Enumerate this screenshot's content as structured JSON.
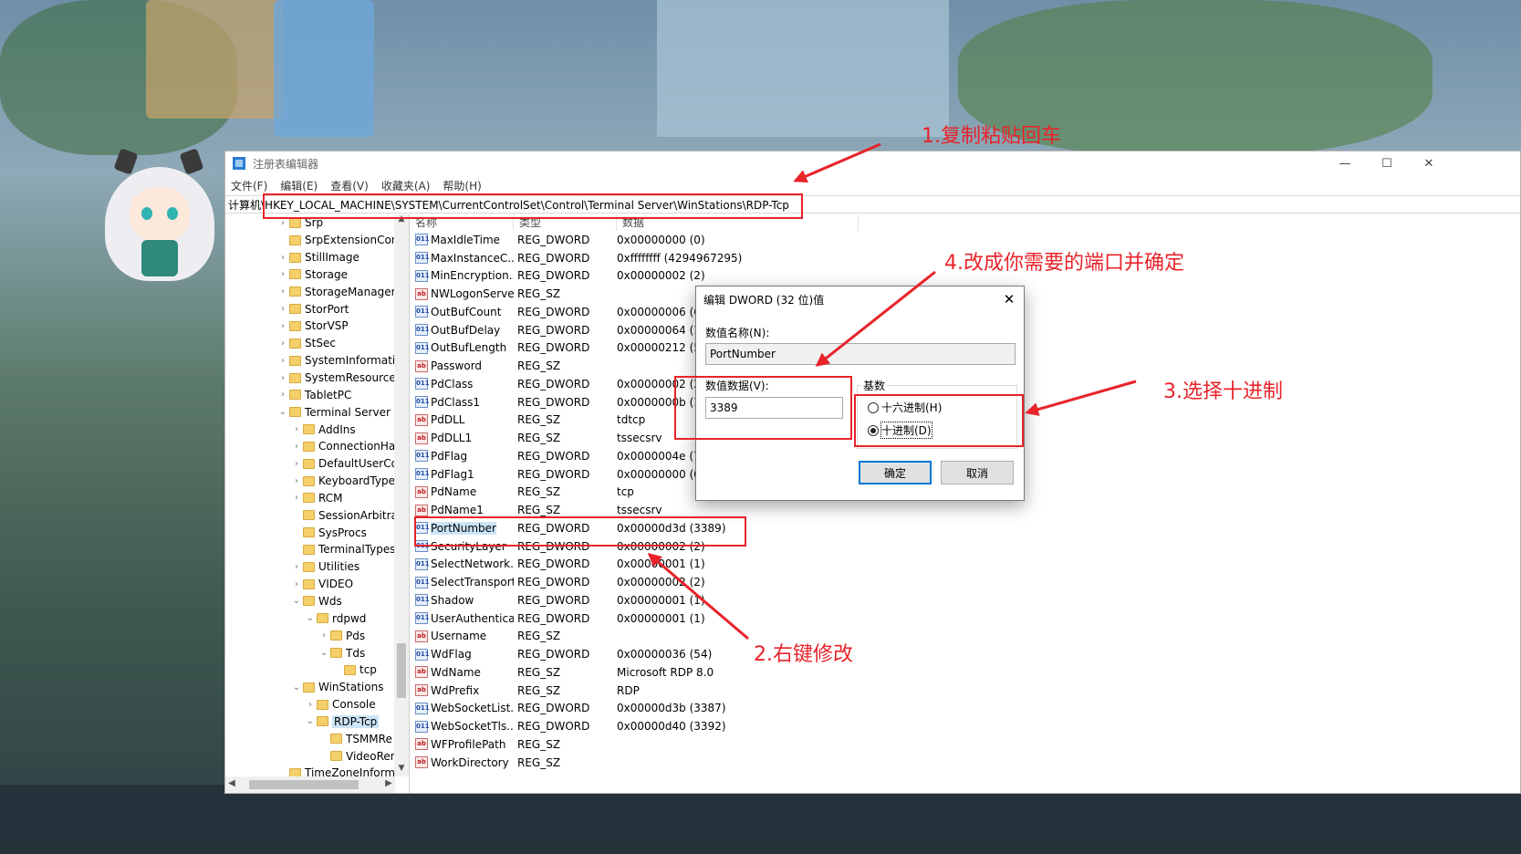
{
  "window": {
    "title": "注册表编辑器",
    "minimize": "—",
    "maximize": "☐",
    "close": "✕",
    "menu": [
      "文件(F)",
      "编辑(E)",
      "查看(V)",
      "收藏夹(A)",
      "帮助(H)"
    ],
    "address": "计算机\\HKEY_LOCAL_MACHINE\\SYSTEM\\CurrentControlSet\\Control\\Terminal Server\\WinStations\\RDP-Tcp"
  },
  "tree": [
    {
      "label": "Srp",
      "level": 0,
      "exp": "›"
    },
    {
      "label": "SrpExtensionConf",
      "level": 0,
      "exp": ""
    },
    {
      "label": "StillImage",
      "level": 0,
      "exp": "›"
    },
    {
      "label": "Storage",
      "level": 0,
      "exp": "›"
    },
    {
      "label": "StorageManagem",
      "level": 0,
      "exp": "›"
    },
    {
      "label": "StorPort",
      "level": 0,
      "exp": "›"
    },
    {
      "label": "StorVSP",
      "level": 0,
      "exp": "›"
    },
    {
      "label": "StSec",
      "level": 0,
      "exp": "›"
    },
    {
      "label": "SystemInformatio",
      "level": 0,
      "exp": "›"
    },
    {
      "label": "SystemResources",
      "level": 0,
      "exp": "›"
    },
    {
      "label": "TabletPC",
      "level": 0,
      "exp": "›"
    },
    {
      "label": "Terminal Server",
      "level": 0,
      "exp": "⌄"
    },
    {
      "label": "AddIns",
      "level": 1,
      "exp": "›"
    },
    {
      "label": "ConnectionHan",
      "level": 1,
      "exp": "›"
    },
    {
      "label": "DefaultUserCor",
      "level": 1,
      "exp": "›"
    },
    {
      "label": "KeyboardType",
      "level": 1,
      "exp": "›"
    },
    {
      "label": "RCM",
      "level": 1,
      "exp": "›"
    },
    {
      "label": "SessionArbitrat",
      "level": 1,
      "exp": ""
    },
    {
      "label": "SysProcs",
      "level": 1,
      "exp": ""
    },
    {
      "label": "TerminalTypes",
      "level": 1,
      "exp": ""
    },
    {
      "label": "Utilities",
      "level": 1,
      "exp": "›"
    },
    {
      "label": "VIDEO",
      "level": 1,
      "exp": "›"
    },
    {
      "label": "Wds",
      "level": 1,
      "exp": "⌄"
    },
    {
      "label": "rdpwd",
      "level": 2,
      "exp": "⌄"
    },
    {
      "label": "Pds",
      "level": 3,
      "exp": "›"
    },
    {
      "label": "Tds",
      "level": 3,
      "exp": "⌄"
    },
    {
      "label": "tcp",
      "level": 4,
      "exp": ""
    },
    {
      "label": "WinStations",
      "level": 1,
      "exp": "⌄"
    },
    {
      "label": "Console",
      "level": 2,
      "exp": "›"
    },
    {
      "label": "RDP-Tcp",
      "level": 2,
      "exp": "⌄",
      "selected": true
    },
    {
      "label": "TSMMRe",
      "level": 3,
      "exp": ""
    },
    {
      "label": "VideoRen",
      "level": 3,
      "exp": ""
    },
    {
      "label": "TimeZoneInforma",
      "level": 0,
      "exp": ""
    }
  ],
  "columns": {
    "name": "名称",
    "type": "类型",
    "data": "数据"
  },
  "values": [
    {
      "name": "MaxIdleTime",
      "type": "REG_DWORD",
      "data": "0x00000000 (0)"
    },
    {
      "name": "MaxInstanceC...",
      "type": "REG_DWORD",
      "data": "0xffffffff (4294967295)"
    },
    {
      "name": "MinEncryption...",
      "type": "REG_DWORD",
      "data": "0x00000002 (2)"
    },
    {
      "name": "NWLogonServer",
      "type": "REG_SZ",
      "data": ""
    },
    {
      "name": "OutBufCount",
      "type": "REG_DWORD",
      "data": "0x00000006 (6)"
    },
    {
      "name": "OutBufDelay",
      "type": "REG_DWORD",
      "data": "0x00000064 (100)"
    },
    {
      "name": "OutBufLength",
      "type": "REG_DWORD",
      "data": "0x00000212 (530)"
    },
    {
      "name": "Password",
      "type": "REG_SZ",
      "data": ""
    },
    {
      "name": "PdClass",
      "type": "REG_DWORD",
      "data": "0x00000002 (2)"
    },
    {
      "name": "PdClass1",
      "type": "REG_DWORD",
      "data": "0x0000000b (11)"
    },
    {
      "name": "PdDLL",
      "type": "REG_SZ",
      "data": "tdtcp"
    },
    {
      "name": "PdDLL1",
      "type": "REG_SZ",
      "data": "tssecsrv"
    },
    {
      "name": "PdFlag",
      "type": "REG_DWORD",
      "data": "0x0000004e (78)"
    },
    {
      "name": "PdFlag1",
      "type": "REG_DWORD",
      "data": "0x00000000 (0)"
    },
    {
      "name": "PdName",
      "type": "REG_SZ",
      "data": "tcp"
    },
    {
      "name": "PdName1",
      "type": "REG_SZ",
      "data": "tssecsrv"
    },
    {
      "name": "PortNumber",
      "type": "REG_DWORD",
      "data": "0x00000d3d (3389)",
      "selected": true
    },
    {
      "name": "SecurityLayer",
      "type": "REG_DWORD",
      "data": "0x00000002 (2)"
    },
    {
      "name": "SelectNetwork...",
      "type": "REG_DWORD",
      "data": "0x00000001 (1)"
    },
    {
      "name": "SelectTransport",
      "type": "REG_DWORD",
      "data": "0x00000002 (2)"
    },
    {
      "name": "Shadow",
      "type": "REG_DWORD",
      "data": "0x00000001 (1)"
    },
    {
      "name": "UserAuthentica...",
      "type": "REG_DWORD",
      "data": "0x00000001 (1)"
    },
    {
      "name": "Username",
      "type": "REG_SZ",
      "data": ""
    },
    {
      "name": "WdFlag",
      "type": "REG_DWORD",
      "data": "0x00000036 (54)"
    },
    {
      "name": "WdName",
      "type": "REG_SZ",
      "data": "Microsoft RDP 8.0"
    },
    {
      "name": "WdPrefix",
      "type": "REG_SZ",
      "data": "RDP"
    },
    {
      "name": "WebSocketList...",
      "type": "REG_DWORD",
      "data": "0x00000d3b (3387)"
    },
    {
      "name": "WebSocketTls...",
      "type": "REG_DWORD",
      "data": "0x00000d40 (3392)"
    },
    {
      "name": "WFProfilePath",
      "type": "REG_SZ",
      "data": ""
    },
    {
      "name": "WorkDirectory",
      "type": "REG_SZ",
      "data": ""
    }
  ],
  "dialog": {
    "title": "编辑 DWORD (32 位)值",
    "close": "✕",
    "name_label": "数值名称(N):",
    "name_value": "PortNumber",
    "data_label": "数值数据(V):",
    "data_value": "3389",
    "base_label": "基数",
    "hex_label": "十六进制(H)",
    "dec_label": "十进制(D)",
    "selected_base": "dec",
    "ok": "确定",
    "cancel": "取消"
  },
  "annotations": {
    "step1": "1.复制粘贴回车",
    "step2": "2.右键修改",
    "step3": "3.选择十进制",
    "step4": "4.改成你需要的端口并确定",
    "color": "#e8232a"
  }
}
